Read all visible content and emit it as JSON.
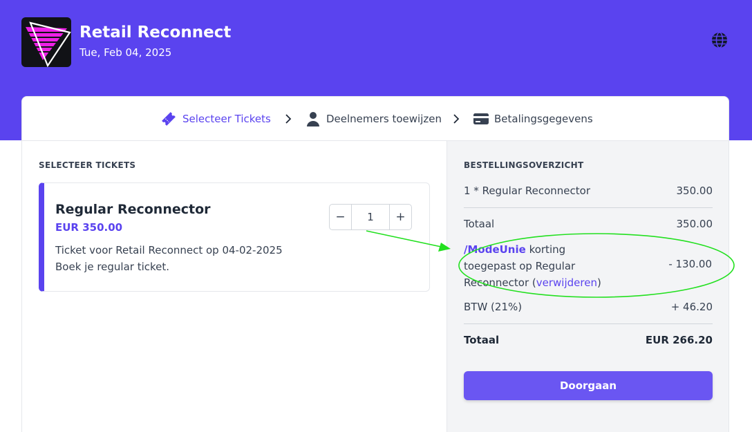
{
  "header": {
    "event_title": "Retail Reconnect",
    "event_date": "Tue, Feb 04, 2025",
    "logo_icon": "retail-reconnect-logo",
    "globe_icon": "globe-icon"
  },
  "steps": [
    {
      "label": "Selecteer Tickets",
      "icon": "ticket-icon",
      "active": true
    },
    {
      "label": "Deelnemers toewijzen",
      "icon": "user-icon",
      "active": false
    },
    {
      "label": "Betalingsgegevens",
      "icon": "credit-card-icon",
      "active": false
    }
  ],
  "tickets_section": {
    "heading": "SELECTEER TICKETS",
    "ticket": {
      "name": "Regular Reconnector",
      "price": "EUR 350.00",
      "desc_line1": "Ticket voor Retail Reconnect op 04-02-2025",
      "desc_line2": "Boek je regular ticket.",
      "quantity": "1",
      "minus": "−",
      "plus": "+"
    }
  },
  "summary": {
    "heading": "BESTELLINGSOVERZICHT",
    "line_item_label": "1 * Regular Reconnector",
    "line_item_amount": "350.00",
    "subtotal_label": "Totaal",
    "subtotal_amount": "350.00",
    "discount": {
      "code": "/ModeUnie",
      "line1_rest": " korting",
      "line2": "toegepast op Regular",
      "line3_prefix": "Reconnector (",
      "remove_link": "verwijderen",
      "line3_suffix": ")",
      "amount": "- 130.00"
    },
    "tax_label": "BTW (21%)",
    "tax_amount": "+ 46.20",
    "total_label": "Totaal",
    "total_amount": "EUR 266.20",
    "continue_label": "Doorgaan"
  },
  "colors": {
    "brand": "#5a43ef",
    "button": "#6a56f2",
    "annotation": "#22e01f"
  }
}
